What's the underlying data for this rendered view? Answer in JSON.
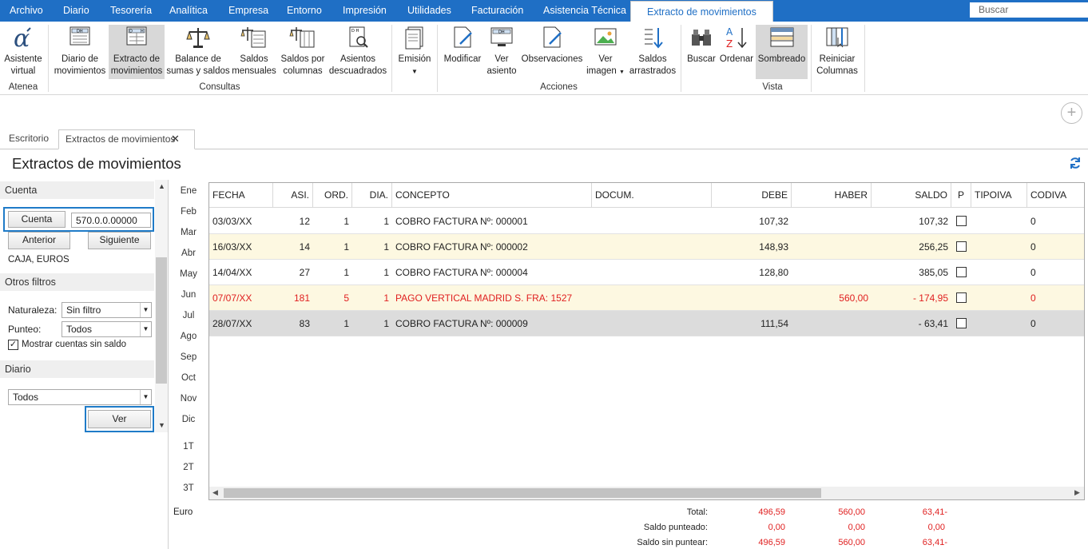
{
  "menubar": {
    "items": [
      "Archivo",
      "Diario",
      "Tesorería",
      "Analítica",
      "Empresa",
      "Entorno",
      "Impresión",
      "Utilidades",
      "Facturación",
      "Asistencia Técnica"
    ],
    "active_tab": "Extracto de movimientos",
    "search_placeholder": "Buscar"
  },
  "ribbon": {
    "groups": {
      "atenea": "Atenea",
      "consultas": "Consultas",
      "acciones": "Acciones",
      "vista": "Vista"
    },
    "buttons": {
      "asistente": [
        "Asistente",
        "virtual"
      ],
      "diario": [
        "Diario de",
        "movimientos"
      ],
      "extracto": [
        "Extracto de",
        "movimientos"
      ],
      "balance": [
        "Balance de",
        "sumas y saldos"
      ],
      "saldos_mensuales": [
        "Saldos",
        "mensuales"
      ],
      "saldos_columnas": [
        "Saldos por",
        "columnas"
      ],
      "asientos": [
        "Asientos",
        "descuadrados"
      ],
      "emision": "Emisión",
      "modificar": "Modificar",
      "ver_asiento": [
        "Ver",
        "asiento"
      ],
      "observaciones": "Observaciones",
      "ver_imagen": [
        "Ver",
        "imagen"
      ],
      "saldos_arrastrados": [
        "Saldos",
        "arrastrados"
      ],
      "buscar": "Buscar",
      "ordenar": "Ordenar",
      "sombreado": "Sombreado",
      "reiniciar": [
        "Reiniciar",
        "Columnas"
      ]
    }
  },
  "tabs": {
    "escritorio": "Escritorio",
    "extractos": "Extractos de movimientos"
  },
  "page_title": "Extractos de movimientos",
  "left": {
    "cuenta_section": "Cuenta",
    "cuenta_button": "Cuenta",
    "cuenta_value": "570.0.0.00000",
    "anterior": "Anterior",
    "siguiente": "Siguiente",
    "account_name": "CAJA, EUROS",
    "otros_filtros": "Otros filtros",
    "naturaleza_label": "Naturaleza:",
    "naturaleza_value": "Sin filtro",
    "punteo_label": "Punteo:",
    "punteo_value": "Todos",
    "mostrar_label": "Mostrar cuentas sin saldo",
    "diario_section": "Diario",
    "diario_value": "Todos",
    "ver": "Ver"
  },
  "months": [
    "Ene",
    "Feb",
    "Mar",
    "Abr",
    "May",
    "Jun",
    "Jul",
    "Ago",
    "Sep",
    "Oct",
    "Nov",
    "Dic"
  ],
  "quarters": [
    "1T",
    "2T",
    "3T"
  ],
  "currency": "Euro",
  "grid": {
    "columns": [
      "FECHA",
      "ASI.",
      "ORD.",
      "DIA.",
      "CONCEPTO",
      "DOCUM.",
      "DEBE",
      "HABER",
      "SALDO",
      "P",
      "TIPOIVA",
      "CODIVA"
    ],
    "rows": [
      {
        "fecha": "03/03/XX",
        "asi": "12",
        "ord": "1",
        "dia": "1",
        "concepto": "COBRO FACTURA Nº: 000001",
        "docum": "",
        "debe": "107,32",
        "haber": "",
        "saldo": "107,32",
        "codiva": "0"
      },
      {
        "fecha": "16/03/XX",
        "asi": "14",
        "ord": "1",
        "dia": "1",
        "concepto": "COBRO FACTURA Nº: 000002",
        "docum": "",
        "debe": "148,93",
        "haber": "",
        "saldo": "256,25",
        "codiva": "0"
      },
      {
        "fecha": "14/04/XX",
        "asi": "27",
        "ord": "1",
        "dia": "1",
        "concepto": "COBRO FACTURA Nº: 000004",
        "docum": "",
        "debe": "128,80",
        "haber": "",
        "saldo": "385,05",
        "codiva": "0"
      },
      {
        "fecha": "07/07/XX",
        "asi": "181",
        "ord": "5",
        "dia": "1",
        "concepto": "PAGO VERTICAL MADRID S. FRA:  1527",
        "docum": "",
        "debe": "",
        "haber": "560,00",
        "saldo": "- 174,95",
        "codiva": "0"
      },
      {
        "fecha": "28/07/XX",
        "asi": "83",
        "ord": "1",
        "dia": "1",
        "concepto": "COBRO FACTURA Nº: 000009",
        "docum": "",
        "debe": "111,54",
        "haber": "",
        "saldo": "- 63,41",
        "codiva": "0"
      }
    ]
  },
  "totals": {
    "total_label": "Total:",
    "punteado_label": "Saldo punteado:",
    "sin_puntear_label": "Saldo sin puntear:",
    "total": [
      "496,59",
      "560,00",
      "63,41-"
    ],
    "punteado": [
      "0,00",
      "0,00",
      "0,00"
    ],
    "sin_puntear": [
      "496,59",
      "560,00",
      "63,41-"
    ]
  },
  "colors": {
    "accent": "#1f6fc5",
    "negative": "#e02020",
    "row_alt": "#fdf8e1",
    "row_selected": "#dcdcdc"
  }
}
